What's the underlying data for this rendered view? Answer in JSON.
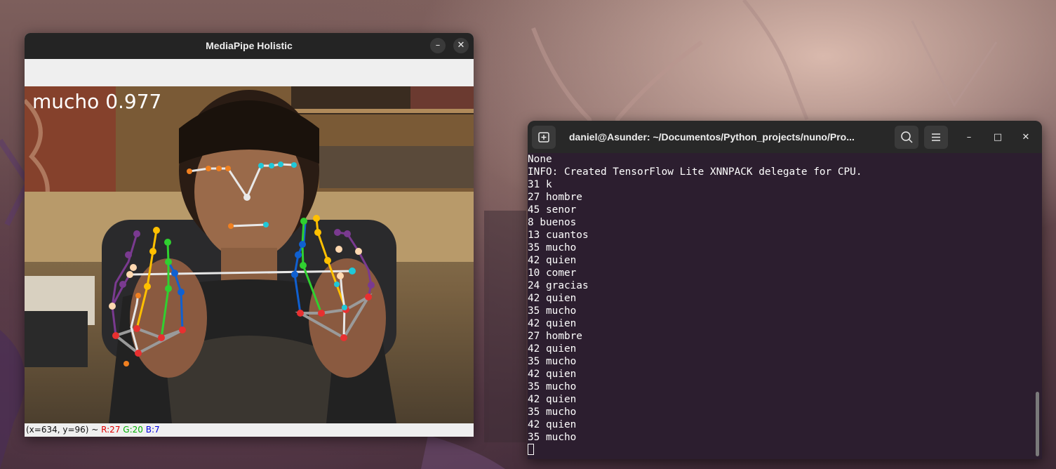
{
  "desktop": {
    "wallpaper": "fantasy-wallpaper"
  },
  "mediapipe_window": {
    "title": "MediaPipe Holistic",
    "minimize_label": "–",
    "close_label": "✕",
    "overlay_text": "mucho 0.977",
    "status": {
      "coords": "(x=634, y=96) ~ ",
      "r": "R:27",
      "g": "G:20",
      "b": "B:7"
    },
    "landmark_colors": {
      "face_left": "#f08020",
      "face_right": "#20c8d8",
      "thumb": "#ffd8b0",
      "index": "#ffc000",
      "middle": "#30d030",
      "ring": "#1060d0",
      "pinky": "#7a3a90",
      "wrist": "#e83030",
      "connector": "#e8e8e8"
    }
  },
  "terminal_window": {
    "title": "daniel@Asunder: ~/Documentos/Python_projects/nuno/Pro...",
    "new_tab_icon": "new-tab-icon",
    "search_icon": "search-icon",
    "menu_icon": "hamburger-menu-icon",
    "minimize_label": "–",
    "maximize_label": "□",
    "close_label": "✕",
    "lines": [
      "None",
      "INFO: Created TensorFlow Lite XNNPACK delegate for CPU.",
      "31 k",
      "27 hombre",
      "45 senor",
      "8 buenos",
      "13 cuantos",
      "35 mucho",
      "42 quien",
      "10 comer",
      "24 gracias",
      "42 quien",
      "35 mucho",
      "42 quien",
      "27 hombre",
      "42 quien",
      "35 mucho",
      "42 quien",
      "35 mucho",
      "42 quien",
      "35 mucho",
      "42 quien",
      "35 mucho"
    ]
  }
}
